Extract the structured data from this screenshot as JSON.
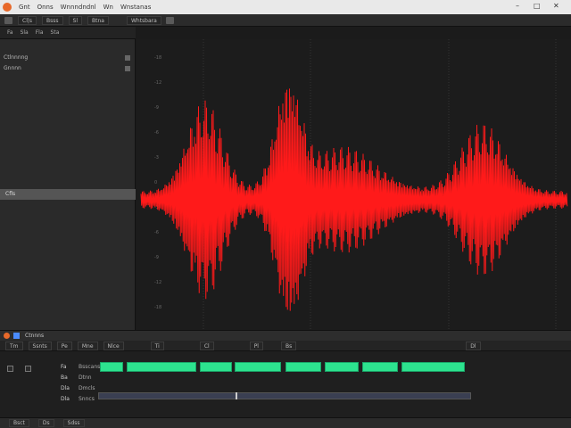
{
  "window": {
    "title_menu": [
      "Gnt",
      "Onns",
      "Wnnndndnl",
      "Wn",
      "Wnstanas"
    ],
    "controls": [
      "–",
      "□",
      "✕"
    ]
  },
  "toolbar": {
    "buttons": [
      "Cl|s",
      "Bsss",
      "Sl",
      "Btna",
      "Whtsbara"
    ]
  },
  "panel": {
    "tabs": [
      "Fa",
      "Sla",
      "Fla",
      "Sta"
    ],
    "rows": [
      "Ctlnnnng",
      "Gnnnn"
    ],
    "selected": "Cfls"
  },
  "waveform": {
    "color": "#ff1a1a",
    "ticks": [
      "-18",
      "-12",
      "-9",
      "-6",
      "-3",
      "0",
      "-3",
      "-6",
      "-9",
      "-12",
      "-18"
    ]
  },
  "bottom": {
    "title": "Ctnnns",
    "toolbar": [
      "Tm",
      "Ssnts",
      "Pe",
      "Mne",
      "Nlce",
      "Ti",
      "Cl",
      "Pl",
      "Bs",
      "Dl"
    ],
    "tracks": [
      {
        "num": "Fa",
        "name": "Bsscans"
      },
      {
        "num": "Ba",
        "name": "Dtnn"
      },
      {
        "num": "Dla",
        "name": "Dmcls"
      },
      {
        "num": "Dla",
        "name": "Snncs"
      }
    ],
    "clip_color": "#2de38f"
  },
  "status": {
    "items": [
      "Bsct",
      "Ds",
      "Sdss"
    ]
  }
}
